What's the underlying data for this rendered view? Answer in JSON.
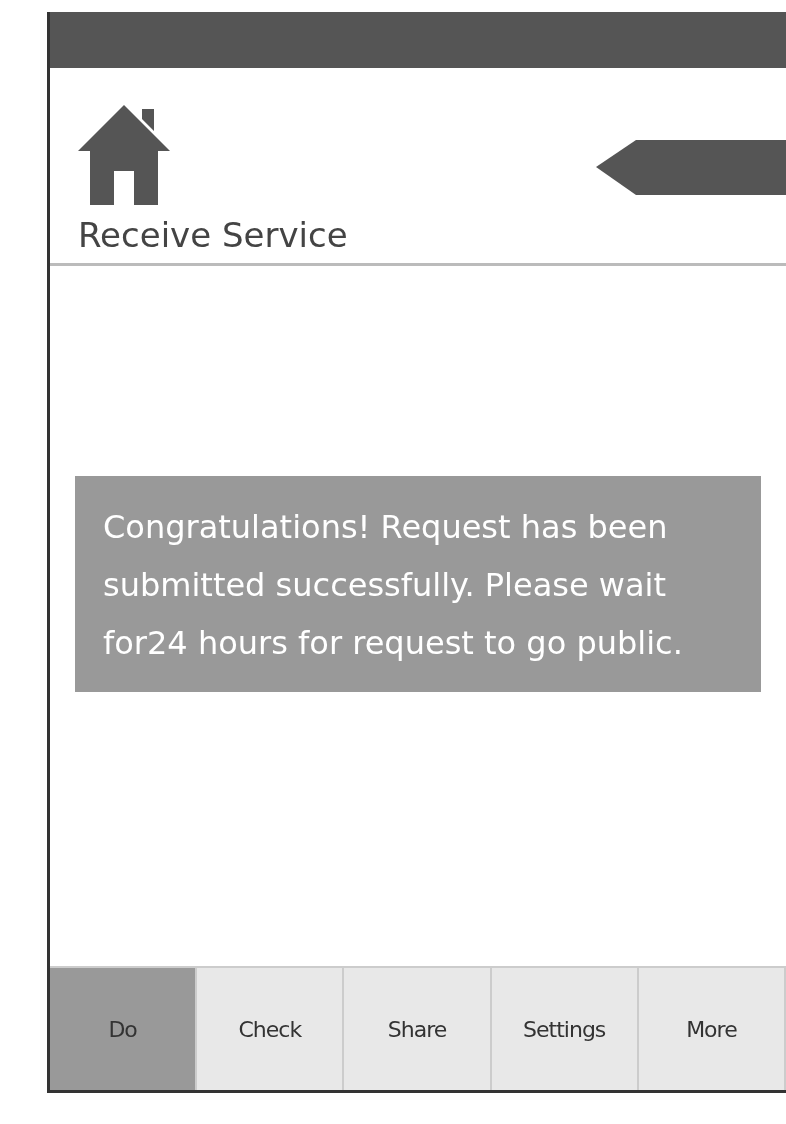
{
  "header": {
    "title": "Receive Service"
  },
  "message": {
    "text": "Congratulations! Request has been submitted successfully. Please wait for24 hours for request to go public."
  },
  "tabs": [
    {
      "label": "Do",
      "selected": true
    },
    {
      "label": "Check",
      "selected": false
    },
    {
      "label": "Share",
      "selected": false
    },
    {
      "label": "Settings",
      "selected": false
    },
    {
      "label": "More",
      "selected": false
    }
  ]
}
